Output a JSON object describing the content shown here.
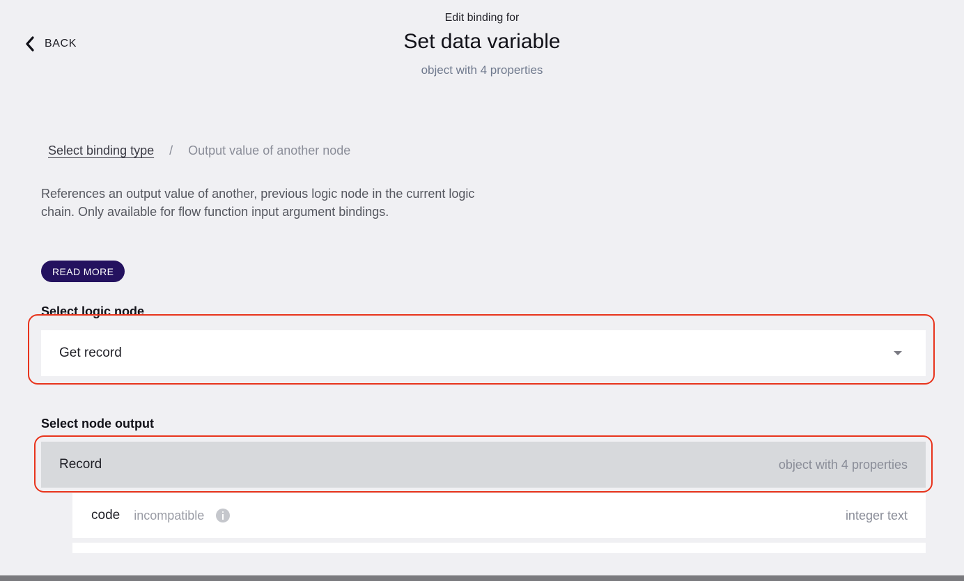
{
  "header": {
    "back_label": "BACK",
    "subtitle": "Edit binding for",
    "title": "Set data variable",
    "type_label": "object with 4 properties"
  },
  "breadcrumb": {
    "link_label": "Select binding type",
    "separator": "/",
    "current": "Output value of another node"
  },
  "description": "References an output value of another, previous logic node in the current logic chain. Only available for flow function input argument bindings.",
  "read_more_label": "READ MORE",
  "logic_node": {
    "label": "Select logic node",
    "selected_value": "Get record"
  },
  "node_output": {
    "label": "Select node output",
    "output": {
      "name": "Record",
      "type": "object with 4 properties"
    },
    "children": [
      {
        "name": "code",
        "status": "incompatible",
        "type": "integer text"
      }
    ]
  },
  "colors": {
    "highlight": "#e8341c",
    "button_bg": "#24125f",
    "background": "#f0f0f3"
  }
}
